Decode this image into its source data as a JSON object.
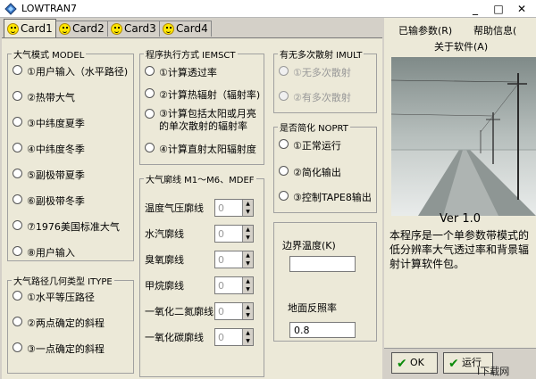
{
  "window": {
    "title": "LOWTRAN7",
    "min": "_",
    "max": "□",
    "close": "✕"
  },
  "tabs": [
    "Card1",
    "Card2",
    "Card3",
    "Card4"
  ],
  "model": {
    "title": "大气模式 MODEL",
    "options": [
      "①用户输入（水平路径)",
      "②热带大气",
      "③中纬度夏季",
      "④中纬度冬季",
      "⑤副极带夏季",
      "⑥副极带冬季",
      "⑦1976美国标准大气",
      "⑧用户输入"
    ]
  },
  "itype": {
    "title": "大气路径几何类型 ITYPE",
    "options": [
      "①水平等压路径",
      "②两点确定的斜程",
      "③一点确定的斜程"
    ]
  },
  "iemsct": {
    "title": "程序执行方式 IEMSCT",
    "options": [
      "①计算透过率",
      "②计算热辐射（辐射率)",
      "③计算包括太阳或月亮的单次散射的辐射率",
      "④计算直射太阳辐射度"
    ]
  },
  "mdef": {
    "title": "大气廓线 M1～M6、MDEF",
    "rows": [
      {
        "label": "温度气压廓线",
        "value": "0"
      },
      {
        "label": "水汽廓线",
        "value": "0"
      },
      {
        "label": "臭氧廓线",
        "value": "0"
      },
      {
        "label": "甲烷廓线",
        "value": "0"
      },
      {
        "label": "一氧化二氮廓线",
        "value": "0"
      },
      {
        "label": "一氧化碳廓线",
        "value": "0"
      }
    ]
  },
  "imult": {
    "title": "有无多次散射 IMULT",
    "options": [
      "①无多次散射",
      "②有多次散射"
    ]
  },
  "noprt": {
    "title": "是否简化 NOPRT",
    "options": [
      "①正常运行",
      "②简化输出",
      "③控制TAPE8输出"
    ]
  },
  "boundary": {
    "temp_label": "边界温度(K)",
    "temp_value": "",
    "albedo_label": "地面反照率",
    "albedo_value": "0.8"
  },
  "side": {
    "tab1": "已输参数(R)",
    "tab2": "帮助信息(",
    "about": "关于软件(A)",
    "version": "Ver 1.0",
    "desc": "本程序是一个单参数带模式的低分辨率大气透过率和背景辐射计算软件包。",
    "ok": "OK",
    "run": "运行"
  },
  "watermark": "I下载网"
}
